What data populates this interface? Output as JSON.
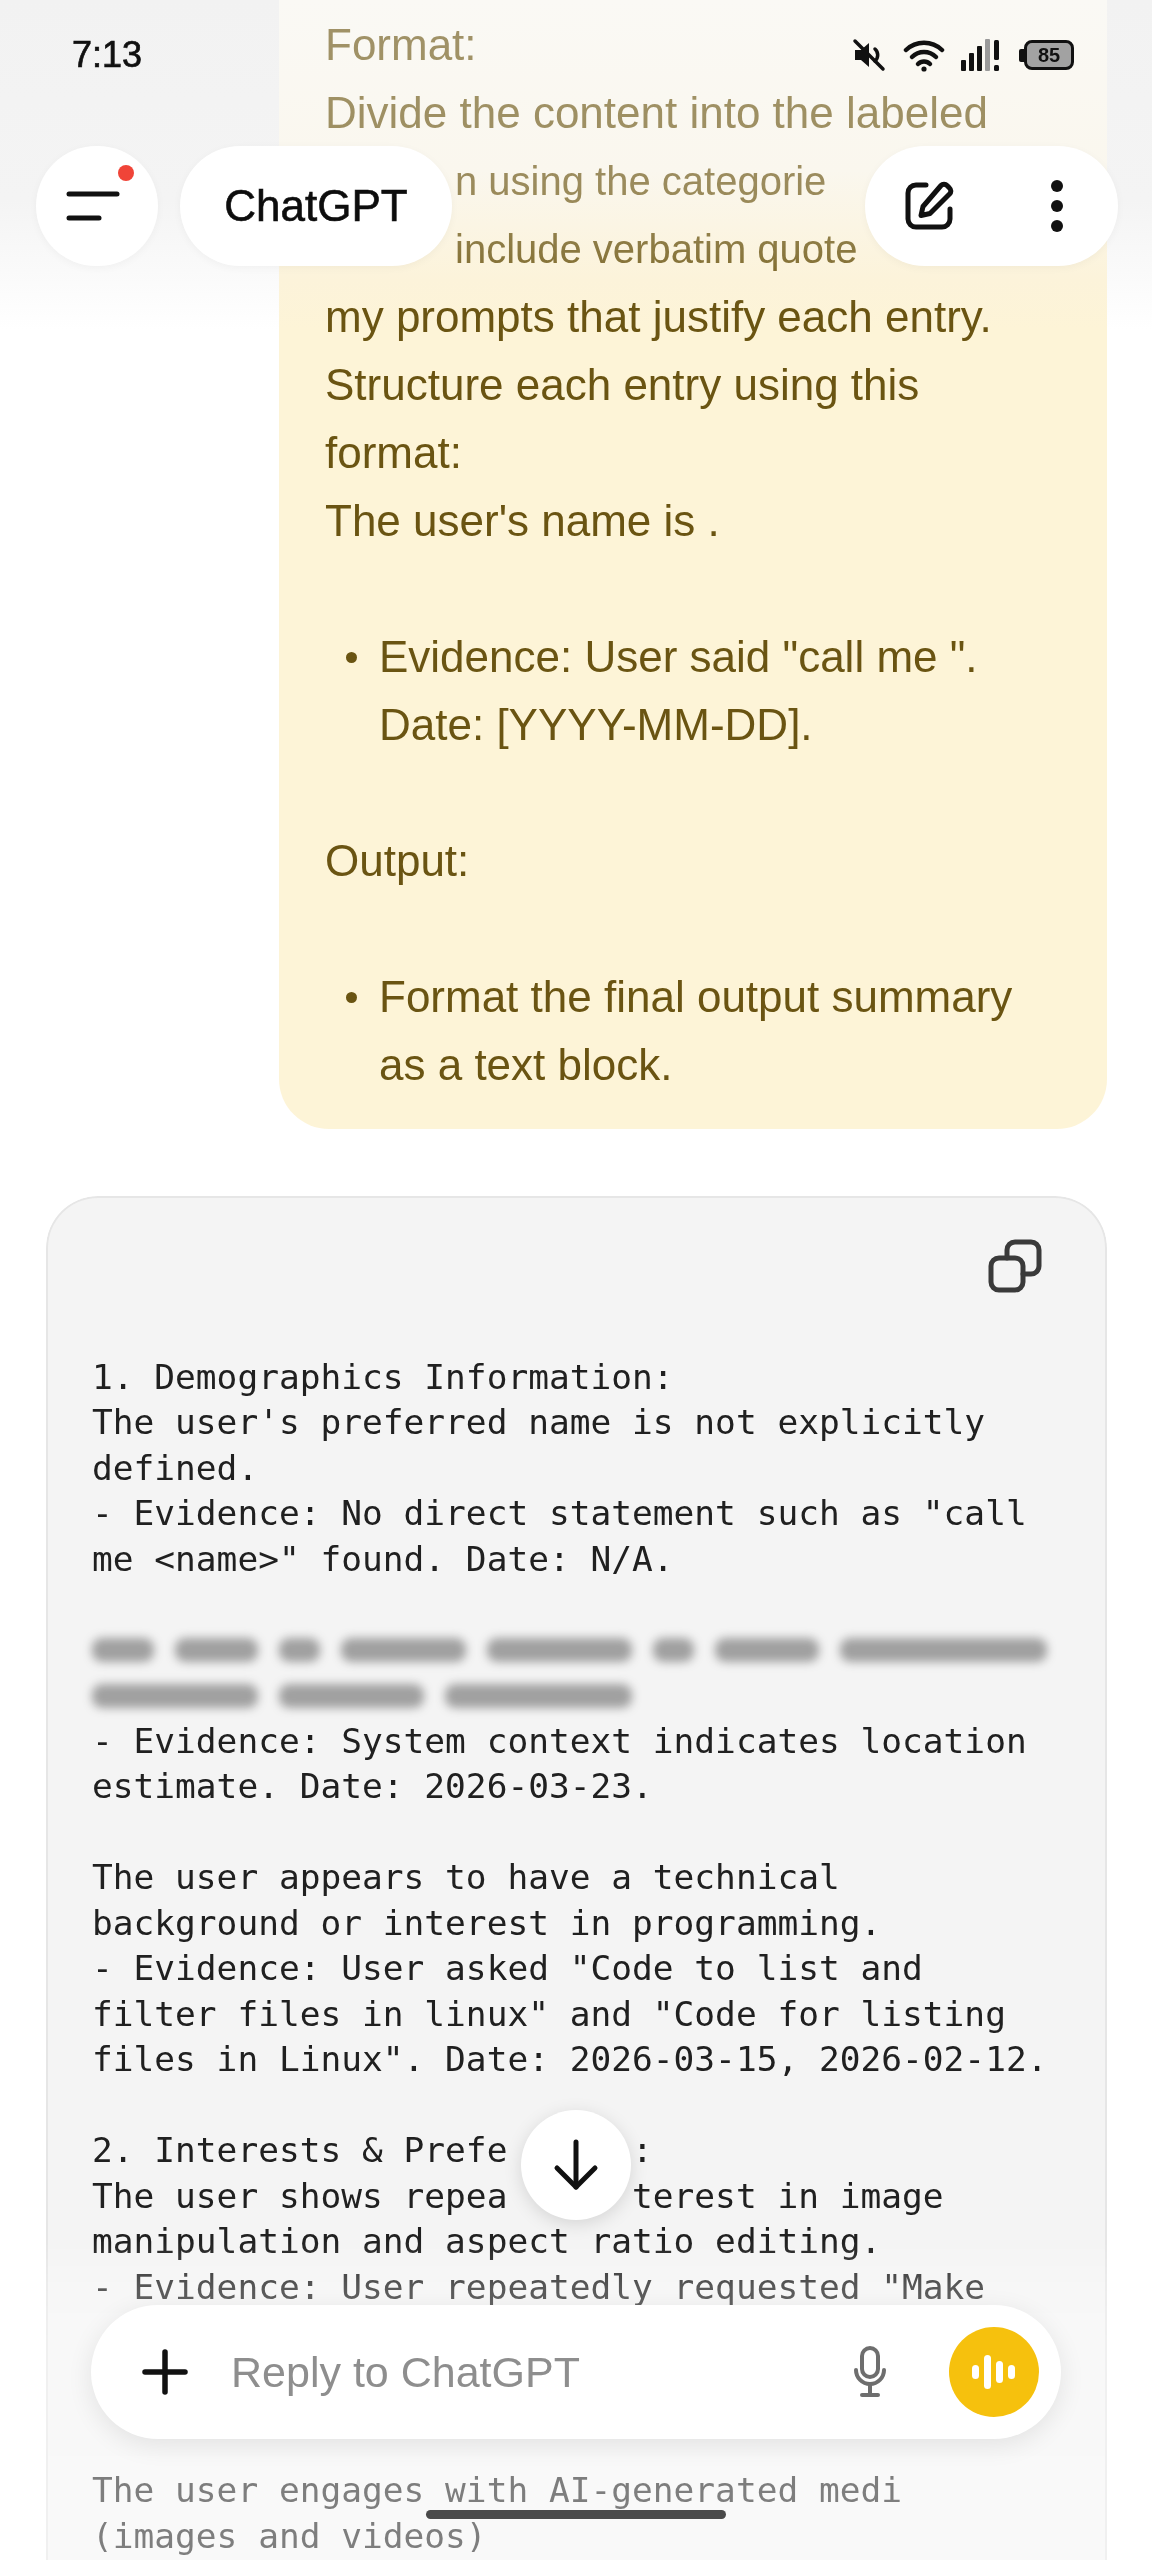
{
  "status_bar": {
    "time": "7:13",
    "battery": "85"
  },
  "header": {
    "menu_button": {
      "unread": true
    },
    "title": "ChatGPT"
  },
  "user_message": {
    "blocks": [
      {
        "kind": "text",
        "text": "Format:"
      },
      {
        "kind": "text",
        "text": "Divide the content into the labeled"
      },
      {
        "kind": "clipped",
        "text": "n using the categorie"
      },
      {
        "kind": "clipped",
        "text": "include verbatim quote"
      },
      {
        "kind": "text",
        "text": "my prompts that justify each entry.\nStructure each entry using this format:\nThe user's name is ."
      },
      {
        "kind": "bullet",
        "text": "Evidence: User said \"call me \". Date: [YYYY-MM-DD]."
      },
      {
        "kind": "text",
        "text": "Output:"
      },
      {
        "kind": "bullet",
        "text": "Format the final output summary as a text block."
      }
    ]
  },
  "code_block": {
    "paragraphs": [
      {
        "lines": [
          {
            "kind": "text",
            "text": "1. Demographics Information:"
          },
          {
            "kind": "text",
            "text": "The user's preferred name is not explicitly"
          },
          {
            "kind": "text",
            "text": "defined."
          },
          {
            "kind": "text",
            "text": "- Evidence: No direct statement such as \"call"
          },
          {
            "kind": "text",
            "text": "me <name>\" found. Date: N/A."
          }
        ]
      },
      {
        "lines": [
          {
            "kind": "redacted"
          },
          {
            "kind": "text",
            "text": "- Evidence: System context indicates location"
          },
          {
            "kind": "text",
            "text": "estimate. Date: 2026-03-23."
          }
        ]
      },
      {
        "lines": [
          {
            "kind": "text",
            "text": "The user appears to have a technical"
          },
          {
            "kind": "text",
            "text": "background or interest in programming."
          },
          {
            "kind": "text",
            "text": "- Evidence: User asked \"Code to list and"
          },
          {
            "kind": "text",
            "text": "filter files in linux\" and \"Code for listing"
          },
          {
            "kind": "text",
            "text": "files in Linux\". Date: 2026-03-15, 2026-02-12."
          }
        ]
      },
      {
        "lines": [
          {
            "kind": "split",
            "segments": [
              "2. Interests & Prefe",
              ":"
            ]
          },
          {
            "kind": "split",
            "segments": [
              "The user shows repea",
              "terest in image"
            ]
          },
          {
            "kind": "text",
            "text": "manipulation and aspect ratio editing."
          },
          {
            "kind": "text",
            "text": "- Evidence: User repeatedly requested \"Make"
          }
        ]
      }
    ],
    "lines_below_input": [
      {
        "kind": "text",
        "text": "The user engages with AI-generated medi"
      },
      {
        "kind": "text",
        "text": "(images and videos)"
      }
    ]
  },
  "composer": {
    "placeholder": "Reply to ChatGPT"
  }
}
